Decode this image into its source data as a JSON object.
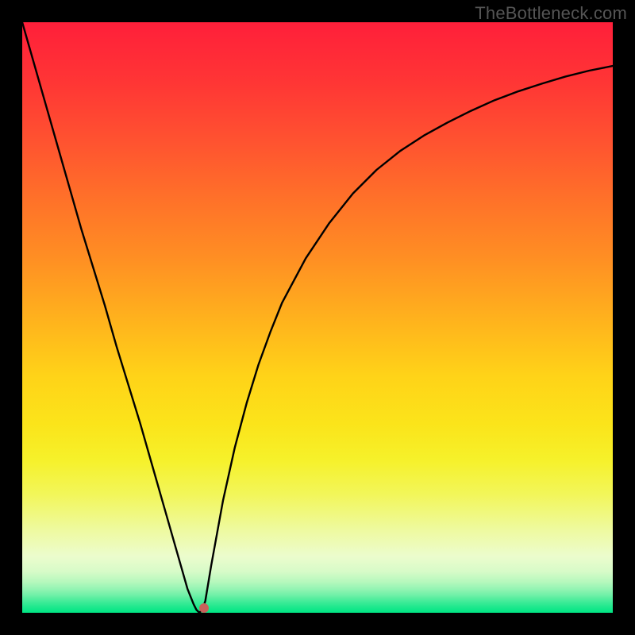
{
  "watermark": "TheBottleneck.com",
  "chart_data": {
    "type": "line",
    "title": "",
    "xlabel": "",
    "ylabel": "",
    "xlim": [
      0,
      100
    ],
    "ylim": [
      0,
      100
    ],
    "x": [
      0,
      2,
      4,
      6,
      8,
      10,
      12,
      14,
      16,
      18,
      20,
      22,
      24,
      26,
      27,
      28,
      29,
      29.5,
      30,
      30.5,
      31,
      32,
      34,
      36,
      38,
      40,
      42,
      44,
      48,
      52,
      56,
      60,
      64,
      68,
      72,
      76,
      80,
      84,
      88,
      92,
      96,
      100
    ],
    "values": [
      100,
      93,
      86,
      79,
      72,
      65,
      58.5,
      52,
      45,
      38.5,
      32,
      25,
      18,
      11,
      7.5,
      4,
      1.5,
      0.5,
      0,
      0.5,
      2,
      8,
      19,
      28,
      35.5,
      42,
      47.5,
      52.5,
      60,
      66,
      71,
      75,
      78.2,
      80.8,
      83,
      85,
      86.8,
      88.3,
      89.6,
      90.8,
      91.8,
      92.6
    ],
    "marker": {
      "x": 30.8,
      "y": 0.8
    },
    "gradient_stops": [
      {
        "pos": 0.0,
        "color": "#ff1f3a"
      },
      {
        "pos": 0.1,
        "color": "#ff3535"
      },
      {
        "pos": 0.2,
        "color": "#ff5230"
      },
      {
        "pos": 0.3,
        "color": "#ff7129"
      },
      {
        "pos": 0.4,
        "color": "#ff8f23"
      },
      {
        "pos": 0.5,
        "color": "#ffb11d"
      },
      {
        "pos": 0.6,
        "color": "#ffd318"
      },
      {
        "pos": 0.68,
        "color": "#fbe41a"
      },
      {
        "pos": 0.74,
        "color": "#f6f12a"
      },
      {
        "pos": 0.8,
        "color": "#f2f65a"
      },
      {
        "pos": 0.86,
        "color": "#eefaa0"
      },
      {
        "pos": 0.905,
        "color": "#ecfccd"
      },
      {
        "pos": 0.93,
        "color": "#d7fbc8"
      },
      {
        "pos": 0.948,
        "color": "#b6f8bd"
      },
      {
        "pos": 0.96,
        "color": "#94f4b3"
      },
      {
        "pos": 0.97,
        "color": "#6ff0a7"
      },
      {
        "pos": 0.98,
        "color": "#46ec9a"
      },
      {
        "pos": 0.99,
        "color": "#1de88d"
      },
      {
        "pos": 1.0,
        "color": "#00e583"
      }
    ]
  }
}
